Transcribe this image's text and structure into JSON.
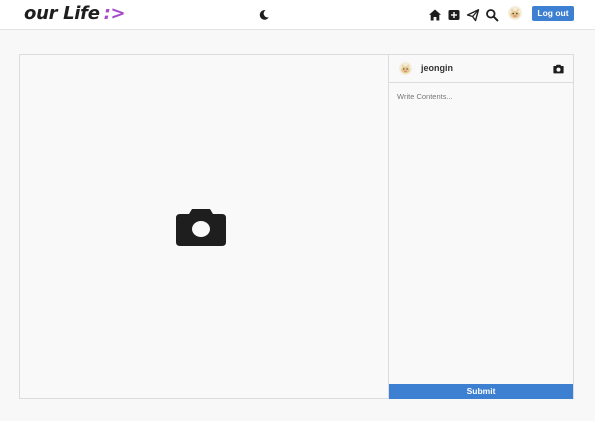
{
  "header": {
    "logo_text": "our Life",
    "logo_smile": ":>",
    "logout_label": "Log out",
    "icons": [
      "moon-icon",
      "home-icon",
      "add-post-icon",
      "send-icon",
      "search-icon",
      "avatar"
    ]
  },
  "post": {
    "author_name": "jeongin",
    "content_placeholder": "Write Contents...",
    "submit_label": "Submit"
  },
  "colors": {
    "accent": "#3d7fd1",
    "logo_smile": "#a64ac9",
    "icon": "#1e1e1e"
  }
}
